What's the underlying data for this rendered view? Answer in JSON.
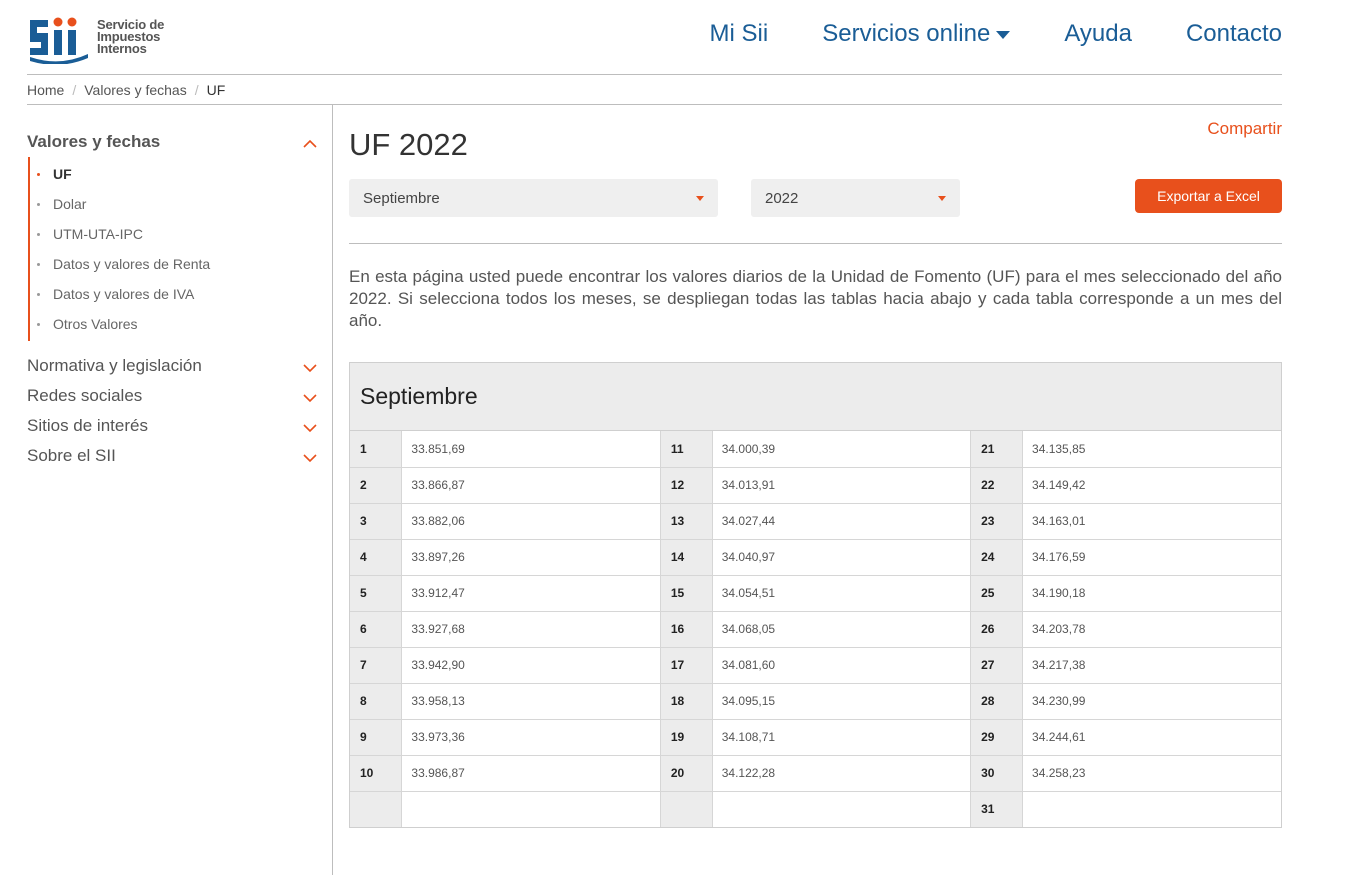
{
  "header": {
    "logo": {
      "mark": "SII",
      "lines": [
        "Servicio de",
        "Impuestos",
        "Internos"
      ]
    },
    "nav": [
      {
        "label": "Mi Sii",
        "has_caret": false
      },
      {
        "label": "Servicios online",
        "has_caret": true
      },
      {
        "label": "Ayuda",
        "has_caret": false
      },
      {
        "label": "Contacto",
        "has_caret": false
      }
    ]
  },
  "breadcrumb": {
    "items": [
      "Home",
      "Valores y fechas"
    ],
    "current": "UF"
  },
  "sidebar": {
    "open_section": {
      "title": "Valores y fechas",
      "items": [
        {
          "label": "UF",
          "active": true
        },
        {
          "label": "Dolar",
          "active": false
        },
        {
          "label": "UTM-UTA-IPC",
          "active": false
        },
        {
          "label": "Datos y valores de Renta",
          "active": false
        },
        {
          "label": "Datos y valores de IVA",
          "active": false
        },
        {
          "label": "Otros Valores",
          "active": false
        }
      ]
    },
    "closed_sections": [
      "Normativa y legislación",
      "Redes sociales",
      "Sitios de interés",
      "Sobre el SII"
    ]
  },
  "main": {
    "share_label": "Compartir",
    "title": "UF 2022",
    "month_select": {
      "value": "Septiembre"
    },
    "year_select": {
      "value": "2022"
    },
    "export_label": "Exportar a Excel",
    "description": "En esta página usted puede encontrar los valores diarios de la Unidad de Fomento (UF) para el mes seleccionado del año 2022. Si selecciona todos los meses, se despliegan todas las tablas hacia abajo y cada tabla corresponde a un mes del año.",
    "table": {
      "month": "Septiembre",
      "rows": [
        [
          [
            "1",
            "33.851,69"
          ],
          [
            "11",
            "34.000,39"
          ],
          [
            "21",
            "34.135,85"
          ]
        ],
        [
          [
            "2",
            "33.866,87"
          ],
          [
            "12",
            "34.013,91"
          ],
          [
            "22",
            "34.149,42"
          ]
        ],
        [
          [
            "3",
            "33.882,06"
          ],
          [
            "13",
            "34.027,44"
          ],
          [
            "23",
            "34.163,01"
          ]
        ],
        [
          [
            "4",
            "33.897,26"
          ],
          [
            "14",
            "34.040,97"
          ],
          [
            "24",
            "34.176,59"
          ]
        ],
        [
          [
            "5",
            "33.912,47"
          ],
          [
            "15",
            "34.054,51"
          ],
          [
            "25",
            "34.190,18"
          ]
        ],
        [
          [
            "6",
            "33.927,68"
          ],
          [
            "16",
            "34.068,05"
          ],
          [
            "26",
            "34.203,78"
          ]
        ],
        [
          [
            "7",
            "33.942,90"
          ],
          [
            "17",
            "34.081,60"
          ],
          [
            "27",
            "34.217,38"
          ]
        ],
        [
          [
            "8",
            "33.958,13"
          ],
          [
            "18",
            "34.095,15"
          ],
          [
            "28",
            "34.230,99"
          ]
        ],
        [
          [
            "9",
            "33.973,36"
          ],
          [
            "19",
            "34.108,71"
          ],
          [
            "29",
            "34.244,61"
          ]
        ],
        [
          [
            "10",
            "33.986,87"
          ],
          [
            "20",
            "34.122,28"
          ],
          [
            "30",
            "34.258,23"
          ]
        ],
        [
          [
            "",
            ""
          ],
          [
            "",
            ""
          ],
          [
            "31",
            ""
          ]
        ]
      ]
    }
  },
  "colors": {
    "accent": "#e8501c",
    "nav_blue": "#1a5d96",
    "logo_blue": "#1a5d96",
    "logo_red": "#e8501c"
  }
}
